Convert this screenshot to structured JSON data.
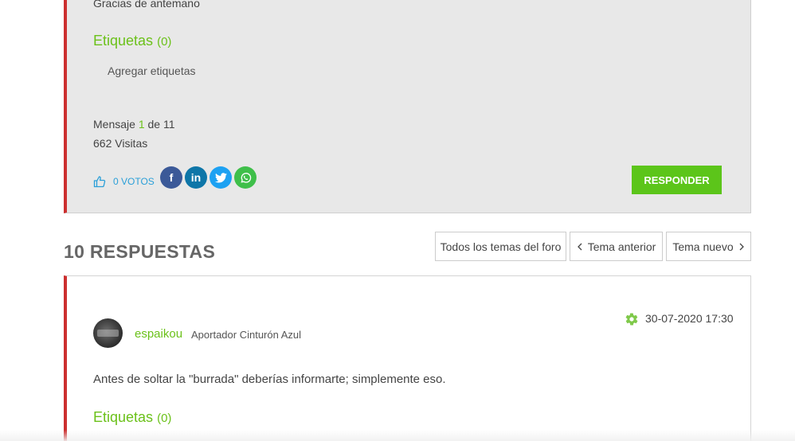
{
  "post": {
    "text_partial": "Gracias de antemano",
    "tags_label": "Etiquetas",
    "tags_count": "(0)",
    "add_tags": "Agregar etiquetas",
    "message_prefix": "Mensaje",
    "message_number": "1",
    "message_suffix": "de 11",
    "visits": "662 Visitas",
    "votes": "0 VOTOS",
    "share_icons": [
      "facebook-icon",
      "linkedin-icon",
      "twitter-icon",
      "whatsapp-icon"
    ],
    "reply_button": "RESPONDER"
  },
  "replies_heading": "10 RESPUESTAS",
  "nav": {
    "all_topics": "Todos los temas del foro",
    "prev_topic": "Tema anterior",
    "next_topic": "Tema nuevo"
  },
  "reply": {
    "author": "espaikou",
    "rank": "Aportador Cinturón Azul",
    "date": "30-07-2020 17:30",
    "text": "Antes de soltar la \"burrada\" deberías informarte; simplemente eso.",
    "tags_label": "Etiquetas",
    "tags_count": "(0)"
  },
  "colors": {
    "accent_green": "#6bc11a",
    "button_green": "#5cc51a",
    "border_red": "#cc2f2f",
    "link_blue": "#2a9fd8"
  }
}
